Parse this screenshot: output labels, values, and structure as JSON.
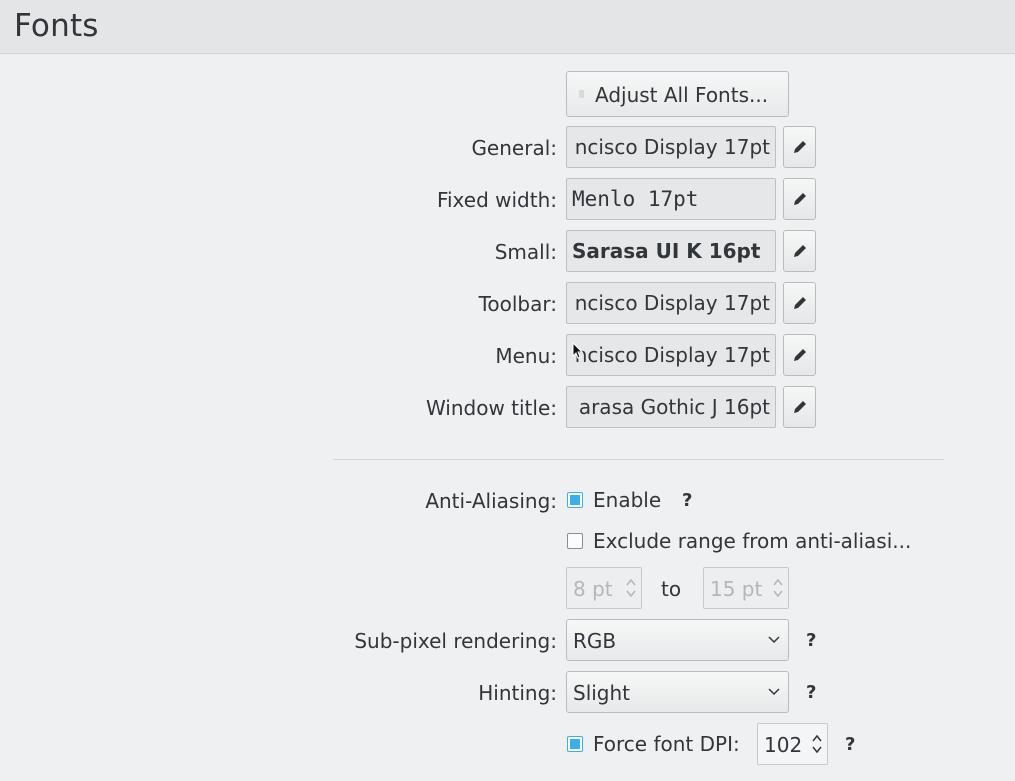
{
  "header": {
    "title": "Fonts"
  },
  "adjust_all": {
    "label": "Adjust All Fonts..."
  },
  "fonts": [
    {
      "label": "General:",
      "value": "ncisco Display 17pt"
    },
    {
      "label": "Fixed width:",
      "value": "Menlo 17pt"
    },
    {
      "label": "Small:",
      "value": "Sarasa UI K 16pt"
    },
    {
      "label": "Toolbar:",
      "value": "ncisco Display 17pt"
    },
    {
      "label": "Menu:",
      "value": "ncisco Display 17pt"
    },
    {
      "label": "Window title:",
      "value": "arasa Gothic J 16pt"
    }
  ],
  "anti_aliasing": {
    "label": "Anti-Aliasing:",
    "enable_label": "Enable",
    "enable_checked": true,
    "help": "?",
    "exclude_label": "Exclude range from anti-aliasi...",
    "exclude_checked": false,
    "range_from": "8 pt",
    "range_to_label": "to",
    "range_to": "15 pt"
  },
  "subpixel": {
    "label": "Sub-pixel rendering:",
    "value": "RGB",
    "help": "?"
  },
  "hinting": {
    "label": "Hinting:",
    "value": "Slight",
    "help": "?"
  },
  "dpi": {
    "label": "Force font DPI:",
    "checked": true,
    "value": "102",
    "help": "?"
  },
  "colors": {
    "accent": "#3daee9",
    "background": "#eff0f1",
    "header": "#e3e5e7"
  },
  "icons": {
    "edit": "pencil-icon",
    "combo": "chevron-down-icon",
    "spin": "up-down-arrows-icon"
  }
}
